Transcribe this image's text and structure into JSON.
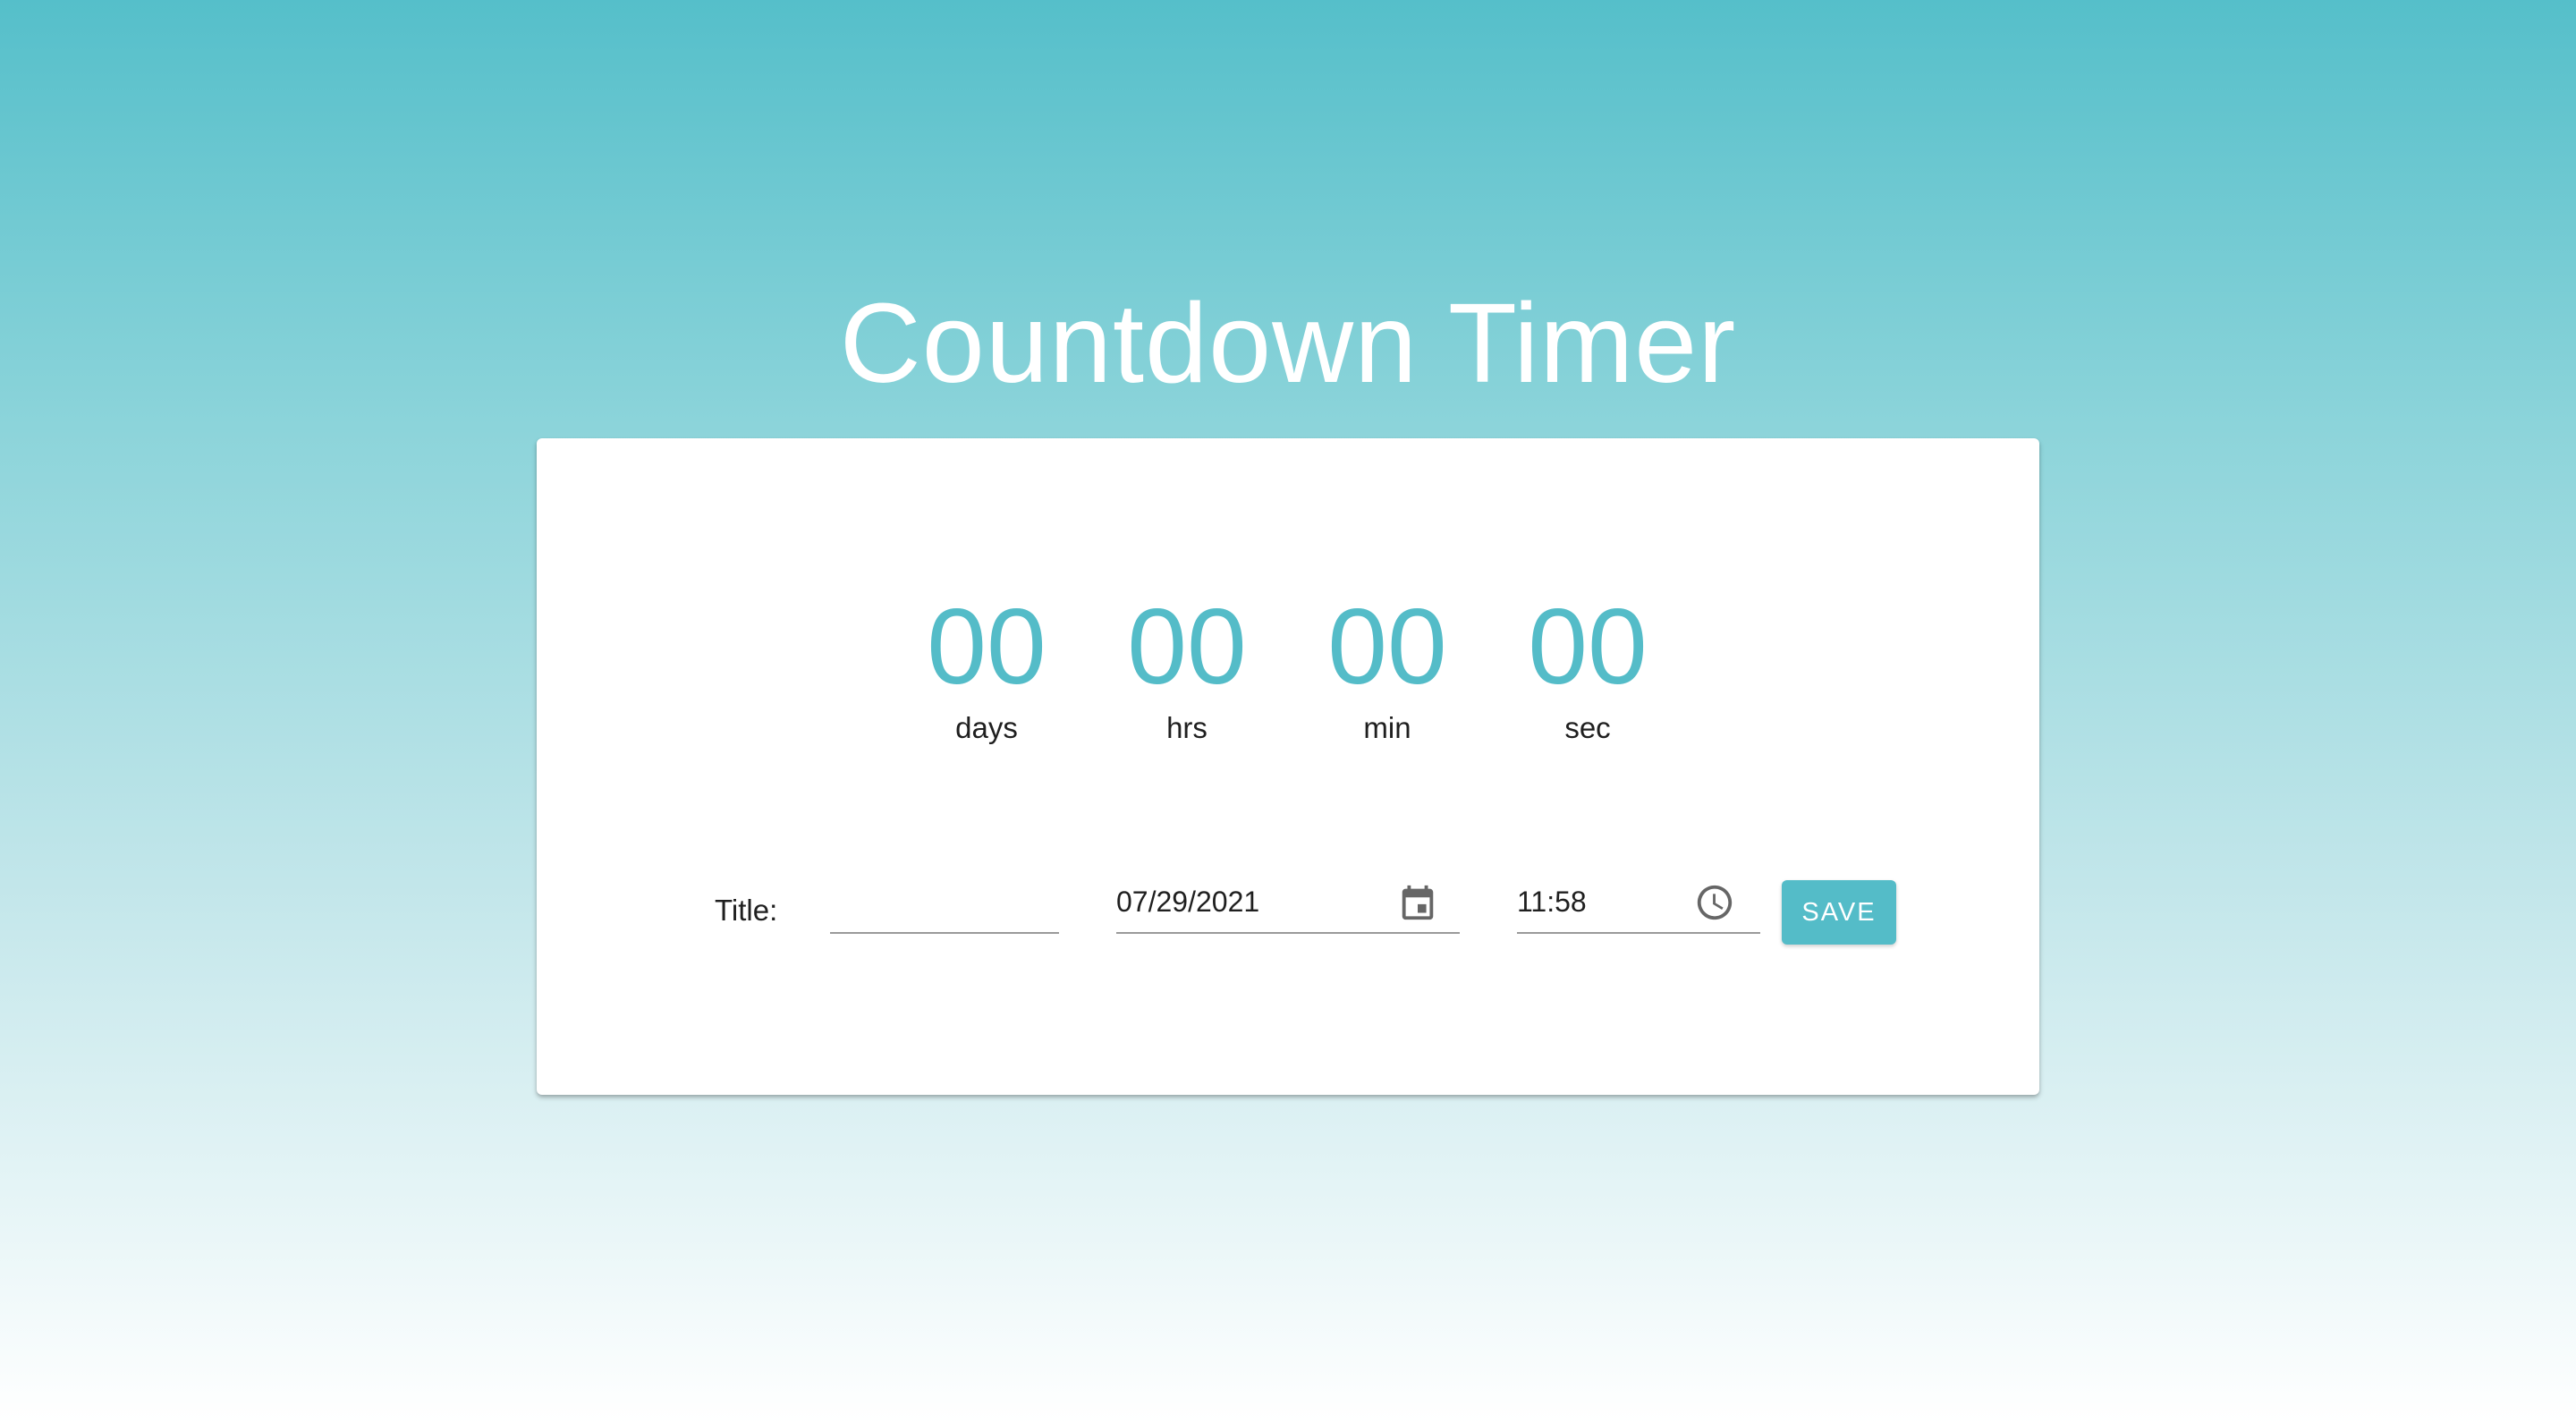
{
  "page": {
    "title": "Countdown Timer"
  },
  "countdown": {
    "units": [
      {
        "value": "00",
        "label": "days"
      },
      {
        "value": "00",
        "label": "hrs"
      },
      {
        "value": "00",
        "label": "min"
      },
      {
        "value": "00",
        "label": "sec"
      }
    ]
  },
  "form": {
    "title_label": "Title:",
    "title_value": "",
    "date_value": "07/29/2021",
    "time_value": "11:58",
    "save_label": "SAVE"
  },
  "icons": {
    "date": "calendar-icon",
    "time": "clock-icon"
  },
  "colors": {
    "accent": "#54bcc8",
    "gradient_top": "#55bfca",
    "gradient_bottom": "#ffffff",
    "card": "#ffffff"
  }
}
